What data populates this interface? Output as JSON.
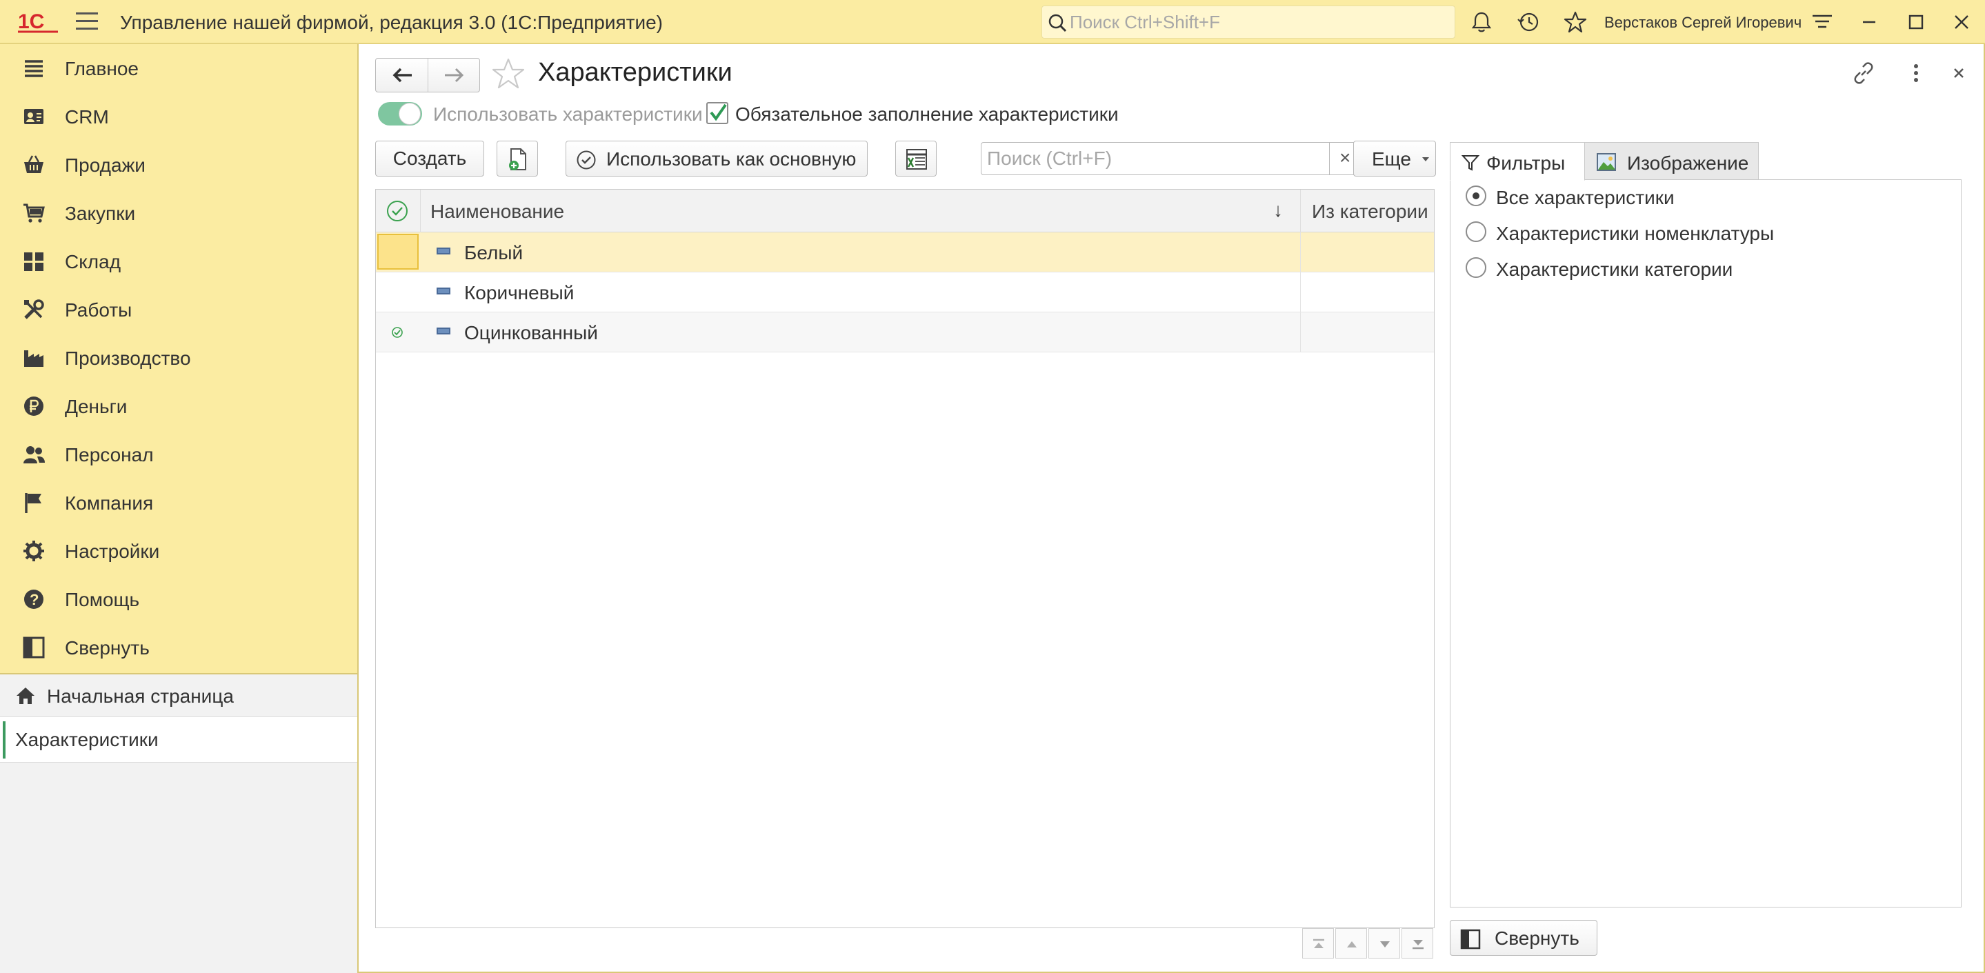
{
  "app": {
    "title": "Управление нашей фирмой, редакция 3.0  (1С:Предприятие)",
    "search_placeholder": "Поиск Ctrl+Shift+F",
    "user": "Верстаков Сергей Игоревич",
    "brand_color": "#d6272d",
    "accent_color": "#fbeca2"
  },
  "sidebar": {
    "items": [
      {
        "label": "Главное",
        "icon": "list-icon"
      },
      {
        "label": "CRM",
        "icon": "contact-card-icon"
      },
      {
        "label": "Продажи",
        "icon": "basket-icon"
      },
      {
        "label": "Закупки",
        "icon": "cart-icon"
      },
      {
        "label": "Склад",
        "icon": "warehouse-grid-icon"
      },
      {
        "label": "Работы",
        "icon": "tools-icon"
      },
      {
        "label": "Производство",
        "icon": "factory-icon"
      },
      {
        "label": "Деньги",
        "icon": "ruble-icon"
      },
      {
        "label": "Персонал",
        "icon": "people-icon"
      },
      {
        "label": "Компания",
        "icon": "flag-icon"
      },
      {
        "label": "Настройки",
        "icon": "gear-icon"
      },
      {
        "label": "Помощь",
        "icon": "help-icon"
      },
      {
        "label": "Свернуть",
        "icon": "collapse-panel-icon"
      }
    ],
    "home": "Начальная страница",
    "current": "Характеристики"
  },
  "form": {
    "title": "Характеристики",
    "use_characteristics_label": "Использовать характеристики",
    "use_characteristics_on": true,
    "required_fill_label": "Обязательное заполнение характеристики",
    "required_fill_checked": true,
    "create_label": "Создать",
    "use_as_main_label": "Использовать как основную",
    "search_placeholder": "Поиск (Ctrl+F)",
    "clear_label": "×",
    "more_label": "Еще",
    "table": {
      "columns": [
        "Наименование",
        "Из категории"
      ],
      "sort_indicator": "↓",
      "rows": [
        {
          "name": "Белый",
          "from_category": "",
          "selected": true,
          "main": false
        },
        {
          "name": "Коричневый",
          "from_category": "",
          "selected": false,
          "main": false
        },
        {
          "name": "Оцинкованный",
          "from_category": "",
          "selected": false,
          "main": true
        }
      ]
    }
  },
  "right_panel": {
    "tabs": [
      {
        "label": "Фильтры",
        "icon": "filter-icon",
        "active": true
      },
      {
        "label": "Изображение",
        "icon": "image-icon",
        "active": false
      }
    ],
    "filters": [
      {
        "label": "Все характеристики",
        "checked": true
      },
      {
        "label": "Характеристики номенклатуры",
        "checked": false
      },
      {
        "label": "Характеристики категории",
        "checked": false
      }
    ],
    "collapse_label": "Свернуть"
  }
}
